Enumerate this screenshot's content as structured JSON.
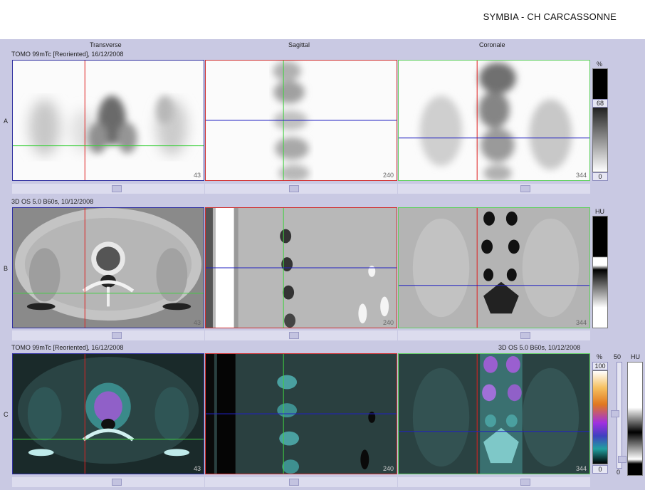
{
  "header": {
    "site": "SYMBIA - CH CARCASSONNE"
  },
  "columns": {
    "transverse": "Transverse",
    "sagittal": "Sagittal",
    "coronal": "Coronale"
  },
  "rows": {
    "a": {
      "label": "A",
      "series": "TOMO 99mTc [Reoriented], 16/12/2008"
    },
    "b": {
      "label": "B",
      "series": "3D  OS  5.0  B60s, 10/12/2008"
    },
    "c": {
      "label": "C",
      "series_left": "TOMO 99mTc [Reoriented], 16/12/2008",
      "series_right": "3D  OS  5.0  B60s, 10/12/2008"
    }
  },
  "slices": {
    "transverse": "43",
    "sagittal": "240",
    "coronal": "344"
  },
  "scales": {
    "a": {
      "unit": "%",
      "max": "68",
      "min": "0"
    },
    "b": {
      "unit": "HU"
    },
    "c": {
      "unit_pct": "%",
      "pct_max": "100",
      "pct_min": "0",
      "blend_max": "50",
      "blend_min": "0",
      "unit_hu": "HU"
    }
  },
  "colors": {
    "cross_red": "#e02020",
    "cross_green": "#40d040",
    "cross_blue": "#2020c0",
    "frame_blue": "#3030a0",
    "frame_red": "#d03030",
    "frame_green": "#60d060"
  }
}
